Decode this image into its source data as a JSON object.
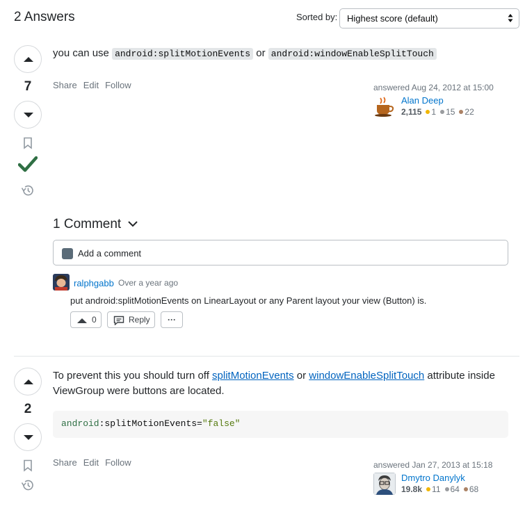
{
  "header": {
    "answers_title": "2 Answers",
    "sort_label": "Sorted by:",
    "sort_value": "Highest score (default)"
  },
  "answer1": {
    "score": "7",
    "accepted": true,
    "body": {
      "prefix": "you can use ",
      "code1": "android:splitMotionEvents",
      "middle": " or ",
      "code2": "android:windowEnableSplitTouch"
    },
    "actions": {
      "share": "Share",
      "edit": "Edit",
      "follow": "Follow"
    },
    "signature": {
      "time": "answered Aug 24, 2012 at 15:00",
      "user": "Alan Deep",
      "rep": "2,115",
      "gold": "1",
      "silver": "15",
      "bronze": "22"
    },
    "comments_title": "1 Comment",
    "add_comment": "Add a comment",
    "comment": {
      "user": "ralphgabb",
      "time": "Over a year ago",
      "text": "put android:splitMotionEvents on LinearLayout or any Parent layout your view (Button) is.",
      "votes": "0",
      "reply": "Reply",
      "more": "···"
    }
  },
  "answer2": {
    "score": "2",
    "body": {
      "prefix": "To prevent this you should turn off ",
      "link1": "splitMotionEvents",
      "middle": " or ",
      "link2": "windowEnableSplitTouch",
      "suffix": " attribute inside ViewGroup were buttons are located."
    },
    "code": {
      "ns": "android",
      "colon": ":",
      "attr": "splitMotionEvents",
      "eq": "=",
      "value": "\"false\""
    },
    "actions": {
      "share": "Share",
      "edit": "Edit",
      "follow": "Follow"
    },
    "signature": {
      "time": "answered Jan 27, 2013 at 15:18",
      "user": "Dmytro Danylyk",
      "rep": "19.8k",
      "gold": "11",
      "silver": "64",
      "bronze": "68"
    }
  },
  "colors": {
    "accepted_check": "#2f6f44",
    "link": "#0063bf",
    "user_link": "#0074cc"
  }
}
